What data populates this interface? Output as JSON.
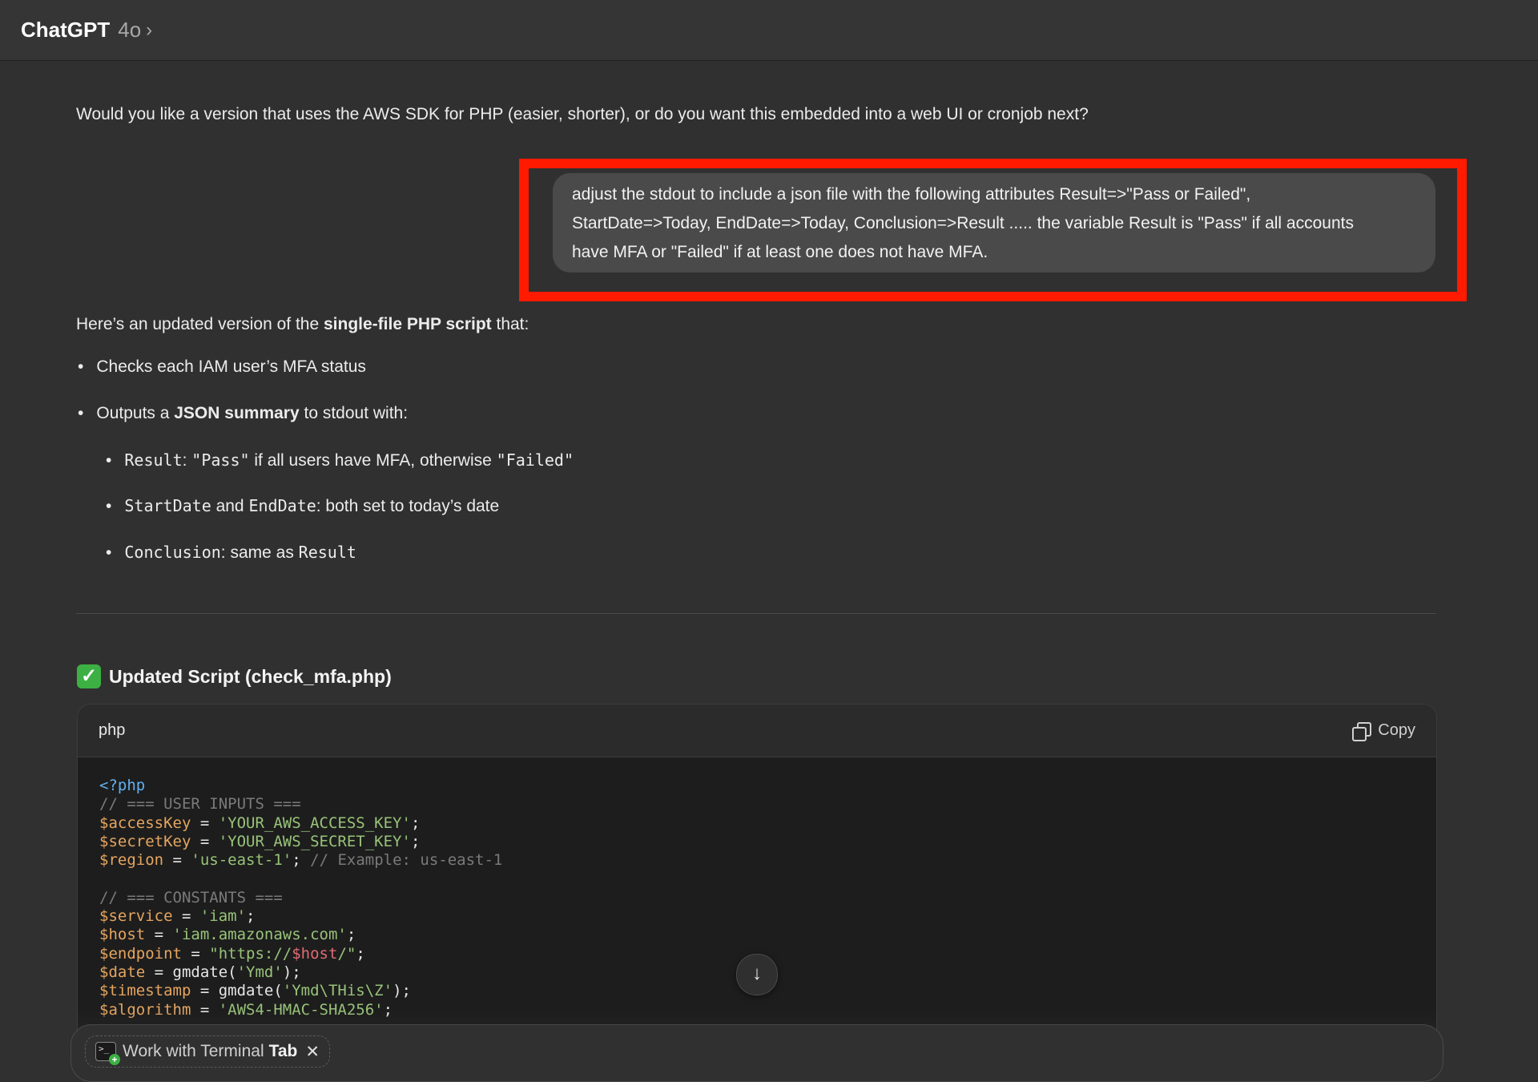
{
  "header": {
    "app_name": "ChatGPT",
    "model": "4o",
    "chevron": "›"
  },
  "assistant_question": "Would you like a version that uses the AWS SDK for PHP (easier, shorter), or do you want this embedded into a web UI or cronjob next?",
  "user_message": {
    "line1": "adjust the stdout to include a json file with the following attributes Result=>\"Pass or Failed\",",
    "line2": "StartDate=>Today, EndDate=>Today, Conclusion=>Result ..... the variable Result is \"Pass\" if all accounts",
    "line3": "have MFA or \"Failed\" if at least one does not have MFA."
  },
  "answer": {
    "intro_pre": "Here’s an updated version of the ",
    "intro_bold": "single-file PHP script",
    "intro_post": " that:",
    "bullet1": "Checks each IAM user’s MFA status",
    "bullet2_pre": "Outputs a ",
    "bullet2_bold": "JSON summary",
    "bullet2_post": " to stdout with:",
    "sub1_code": "Result",
    "sub1_mid": ": ",
    "sub1_code2": "\"Pass\"",
    "sub1_text": " if all users have MFA, otherwise ",
    "sub1_code3": "\"Failed\"",
    "sub2_code": "StartDate",
    "sub2_mid": " and ",
    "sub2_code2": "EndDate",
    "sub2_text": ": both set to today’s date",
    "sub3_code": "Conclusion",
    "sub3_text": ": same as ",
    "sub3_code2": "Result",
    "section_heading": "Updated Script (check_mfa.php)",
    "heading_icon": "check-mark-icon"
  },
  "code_block": {
    "language": "php",
    "copy_label": "Copy",
    "lines": {
      "l1": "<?php",
      "l2": "// === USER INPUTS ===",
      "l3_var": "$accessKey",
      "l3_str": "'YOUR_AWS_ACCESS_KEY'",
      "l4_var": "$secretKey",
      "l4_str": "'YOUR_AWS_SECRET_KEY'",
      "l5_var": "$region",
      "l5_str": "'us-east-1'",
      "l5_comment": "// Example: us-east-1",
      "l7": "// === CONSTANTS ===",
      "l8_var": "$service",
      "l8_str": "'iam'",
      "l9_var": "$host",
      "l9_str": "'iam.amazonaws.com'",
      "l10_var": "$endpoint",
      "l10_str1": "\"https://",
      "l10_interp": "$host",
      "l10_str2": "/\"",
      "l11_var": "$date",
      "l11_fn": "gmdate(",
      "l11_str": "'Ymd'",
      "l11_end": ");",
      "l12_var": "$timestamp",
      "l12_fn": "gmdate(",
      "l12_str": "'Ymd\\THis\\Z'",
      "l12_end": ");",
      "l13_var": "$algorithm",
      "l13_str": "'AWS4-HMAC-SHA256'"
    }
  },
  "composer": {
    "chip_text": "Work with Terminal",
    "chip_bold": "Tab",
    "chip_close": "✕"
  },
  "scroll_down_icon": "↓"
}
